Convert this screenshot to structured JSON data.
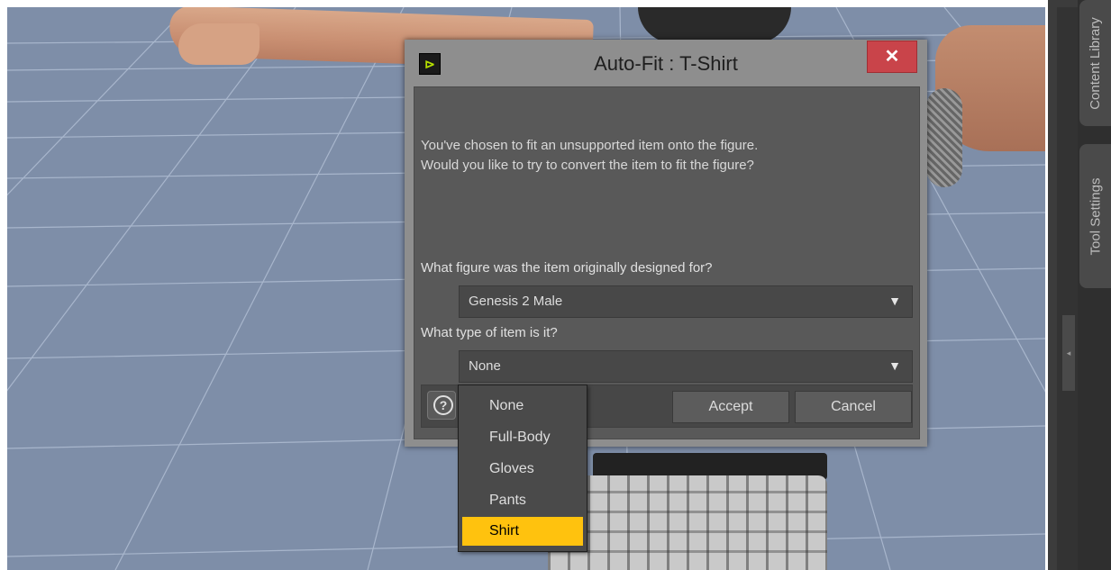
{
  "dialog": {
    "title": "Auto-Fit : T-Shirt",
    "close_glyph": "✕",
    "icon_glyph": "⊳",
    "message_line1": "You've chosen to fit an unsupported item onto the figure.",
    "message_line2": "Would you like to try to convert the item to fit the figure?",
    "figure_question": "What figure was the item originally designed for?",
    "figure_value": "Genesis 2 Male",
    "type_question": "What type of item is it?",
    "type_value": "None",
    "arrow_glyph": "▼",
    "help_glyph": "?",
    "accept_label": "Accept",
    "cancel_label": "Cancel"
  },
  "dropdown": {
    "options": [
      "None",
      "Full-Body",
      "Gloves",
      "Pants",
      "Shirt"
    ],
    "highlighted": "Shirt"
  },
  "side_panel": {
    "tabs": [
      "Content Library",
      "Tool Settings"
    ],
    "collapse_glyph": "◂"
  },
  "colors": {
    "highlight": "#ffc20e",
    "close_button": "#c9444a",
    "viewport_floor": "#7e8ea8"
  }
}
